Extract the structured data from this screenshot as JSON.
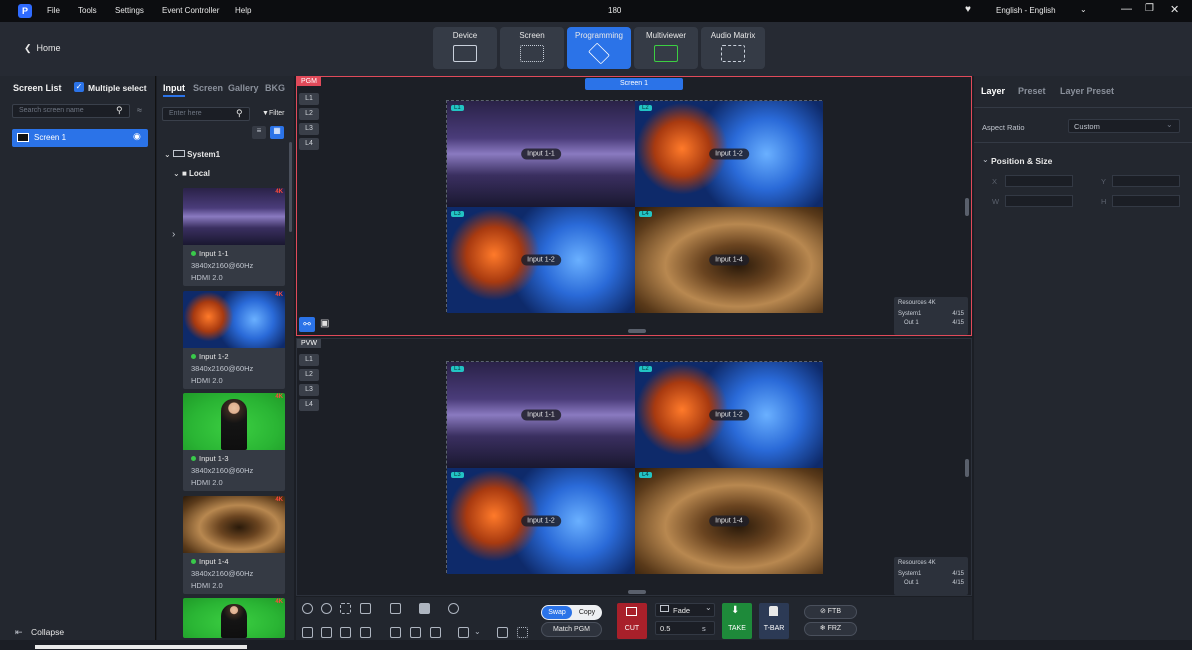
{
  "menubar": {
    "logo": "P",
    "items": [
      "File",
      "Tools",
      "Settings",
      "Event Controller",
      "Help"
    ],
    "title": "180",
    "language": "English - English"
  },
  "toolbar": {
    "home": "Home",
    "tabs": [
      "Device",
      "Screen",
      "Programming",
      "Multiviewer",
      "Audio Matrix"
    ],
    "active_tab": "Programming"
  },
  "screen_list": {
    "title": "Screen List",
    "multiple_select": "Multiple select",
    "search_placeholder": "Search screen name",
    "items": [
      "Screen 1"
    ],
    "collapse": "Collapse"
  },
  "source_panel": {
    "tabs": [
      "Input",
      "Screen",
      "Gallery",
      "BKG"
    ],
    "search_placeholder": "Enter here",
    "filter": "Filter",
    "tree_system": "System1",
    "tree_local": "Local",
    "inputs": [
      {
        "name": "Input 1-1",
        "resolution": "3840x2160@60Hz",
        "port": "HDMI 2.0",
        "badge": "4K"
      },
      {
        "name": "Input 1-2",
        "resolution": "3840x2160@60Hz",
        "port": "HDMI 2.0",
        "badge": "4K"
      },
      {
        "name": "Input 1-3",
        "resolution": "3840x2160@60Hz",
        "port": "HDMI 2.0",
        "badge": "4K"
      },
      {
        "name": "Input 1-4",
        "resolution": "3840x2160@60Hz",
        "port": "HDMI 2.0",
        "badge": "4K"
      },
      {
        "badge": "4K"
      }
    ]
  },
  "pgm": {
    "tag": "PGM",
    "screen_name": "Screen 1",
    "layers": [
      "L1",
      "L2",
      "L3",
      "L4"
    ],
    "tiles": [
      {
        "badge": "L1",
        "label": "Input 1-1"
      },
      {
        "badge": "L2",
        "label": "Input 1-2"
      },
      {
        "badge": "L3",
        "label": "Input 1-2"
      },
      {
        "badge": "L4",
        "label": "Input 1-4"
      }
    ],
    "resources": {
      "title": "Resources 4K",
      "row1_label": "System1",
      "row1_value": "4/15",
      "row2_label": "Out 1",
      "row2_value": "4/15"
    }
  },
  "pvw": {
    "tag": "PVW",
    "layers": [
      "L1",
      "L2",
      "L3",
      "L4"
    ],
    "tiles": [
      {
        "badge": "L1",
        "label": "Input 1-1"
      },
      {
        "badge": "L2",
        "label": "Input 1-2"
      },
      {
        "badge": "L3",
        "label": "Input 1-2"
      },
      {
        "badge": "L4",
        "label": "Input 1-4"
      }
    ],
    "resources": {
      "title": "Resources 4K",
      "row1_label": "System1",
      "row1_value": "4/15",
      "row2_label": "Out 1",
      "row2_value": "4/15"
    }
  },
  "controls": {
    "swap": "Swap",
    "copy": "Copy",
    "match_pgm": "Match PGM",
    "cut": "CUT",
    "effect": "Fade",
    "duration": "0.5",
    "duration_unit": "s",
    "take": "TAKE",
    "tbar": "T-BAR",
    "ftb": "FTB",
    "frz": "FRZ"
  },
  "properties": {
    "tabs": [
      "Layer",
      "Preset",
      "Layer Preset"
    ],
    "aspect_ratio_label": "Aspect Ratio",
    "aspect_ratio_value": "Custom",
    "section": "Position & Size",
    "x": "X",
    "y": "Y",
    "w": "W",
    "h": "H"
  }
}
